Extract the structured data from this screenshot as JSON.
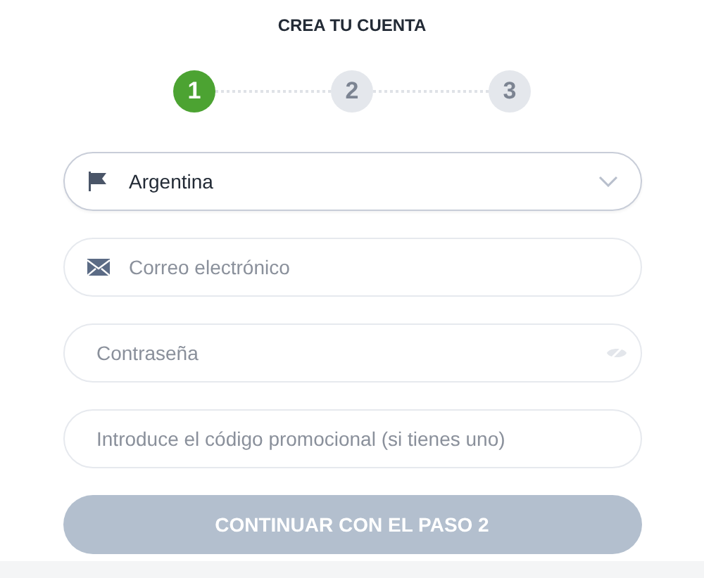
{
  "title": "CREA TU CUENTA",
  "steps": [
    {
      "label": "1",
      "selected": true
    },
    {
      "label": "2",
      "selected": false
    },
    {
      "label": "3",
      "selected": false
    }
  ],
  "fields": [
    {
      "kind": "country",
      "value": "Argentina"
    },
    {
      "kind": "email",
      "placeholder": "Correo electrónico"
    },
    {
      "kind": "password",
      "placeholder": "Contraseña"
    },
    {
      "kind": "promo",
      "placeholder": "Introduce el código promocional (si tienes uno)"
    }
  ],
  "submit": {
    "label": "CONTINUAR CON EL PASO 2",
    "disabled": true
  }
}
